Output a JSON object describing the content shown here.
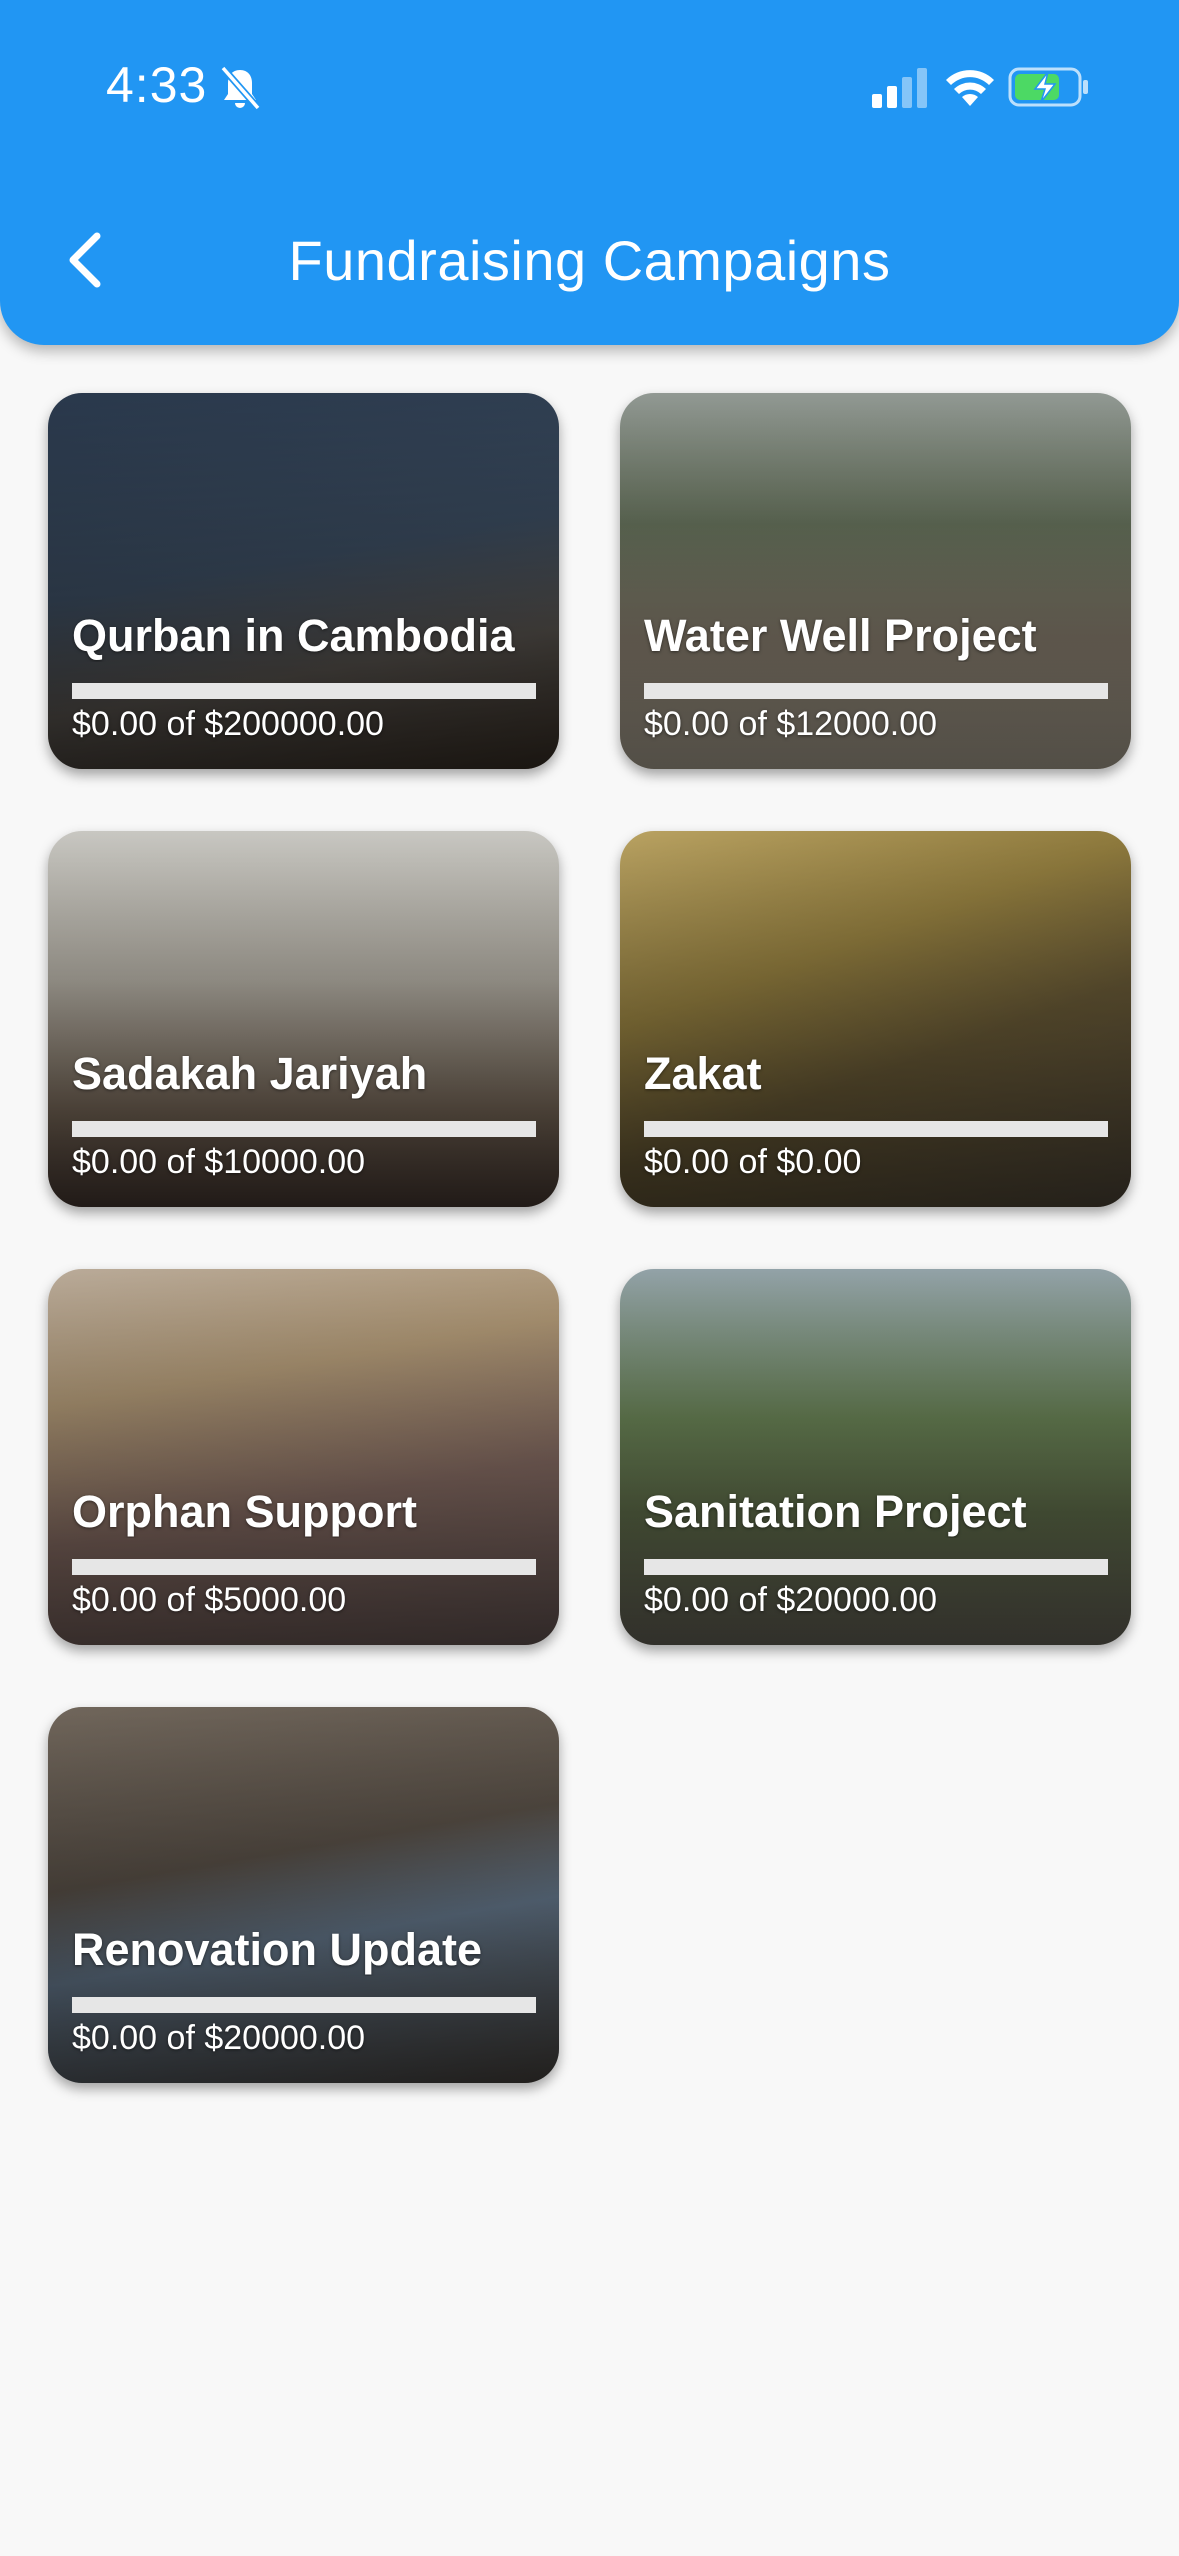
{
  "status_bar": {
    "time": "4:33",
    "icons": [
      "bell-slash-icon",
      "signal-icon",
      "wifi-icon",
      "battery-charging-icon"
    ]
  },
  "header": {
    "title": "Fundraising Campaigns",
    "back_icon": "chevron-left-icon"
  },
  "colors": {
    "primary": "#2196f3",
    "background": "#f8f8f8",
    "progress_track": "#e6e6e6"
  },
  "campaigns": [
    {
      "title": "Qurban in Cambodia",
      "amount": "$0.00 of $200000.00",
      "progress": 0
    },
    {
      "title": "Water Well Project",
      "amount": "$0.00 of $12000.00",
      "progress": 0
    },
    {
      "title": "Sadakah Jariyah",
      "amount": "$0.00 of $10000.00",
      "progress": 0
    },
    {
      "title": "Zakat",
      "amount": "$0.00 of $0.00",
      "progress": 0
    },
    {
      "title": "Orphan Support",
      "amount": "$0.00 of $5000.00",
      "progress": 0
    },
    {
      "title": "Sanitation Project",
      "amount": "$0.00 of $20000.00",
      "progress": 0
    },
    {
      "title": "Renovation Update",
      "amount": "$0.00 of $20000.00",
      "progress": 0
    }
  ]
}
